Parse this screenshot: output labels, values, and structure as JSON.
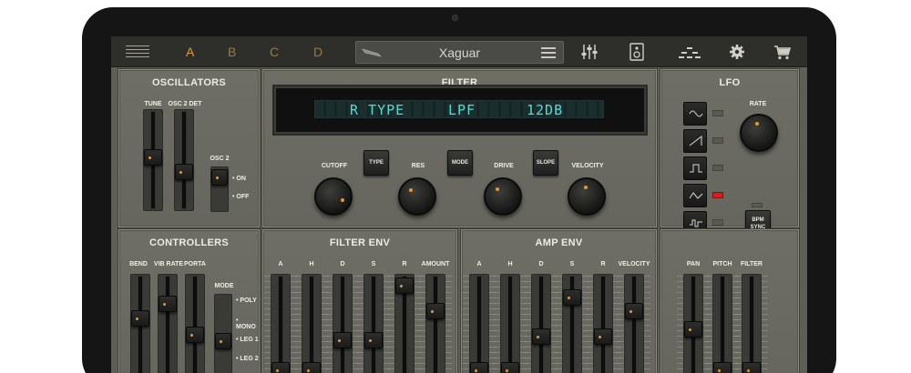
{
  "topbar": {
    "preset_slots": [
      "A",
      "B",
      "C",
      "D"
    ],
    "preset_name": "Xaguar",
    "icons": [
      "mixer-icon",
      "speaker-icon",
      "sequencer-icon",
      "gear-icon",
      "cart-icon"
    ],
    "active_slot_color": "#e69838",
    "slot_color": "#9c7a3e"
  },
  "oscillators": {
    "title": "OSCILLATORS",
    "tune_label": "TUNE",
    "osc2det_label": "OSC 2 DET",
    "osc2_label": "OSC 2",
    "on_label": "ON",
    "off_label": "OFF"
  },
  "filter": {
    "title": "FILTER",
    "display": {
      "param": "R TYPE",
      "value": "LPF",
      "slope": "12DB"
    },
    "display_color": "#5ed8cf",
    "buttons": [
      "TYPE",
      "MODE",
      "SLOPE"
    ],
    "knobs": [
      "CUTOFF",
      "RES",
      "DRIVE",
      "VELOCITY"
    ]
  },
  "lfo": {
    "title": "LFO",
    "rate_label": "RATE",
    "bpm_sync_line1": "BPM",
    "bpm_sync_line2": "SYNC",
    "waveforms": [
      "sine-wave-icon",
      "saw-wave-icon",
      "square-wave-icon",
      "triangle-wave-icon",
      "random-wave-icon"
    ],
    "active_index": 3
  },
  "controllers": {
    "title": "CONTROLLERS",
    "bend_label": "BEND",
    "vib_rate_label": "VIB RATE",
    "porta_label": "PORTA",
    "mode_label": "MODE",
    "modes": [
      "POLY",
      "MONO",
      "LEG 1",
      "LEG 2"
    ]
  },
  "filter_env": {
    "title": "FILTER ENV",
    "labels": [
      "A",
      "H",
      "D",
      "S",
      "R",
      "AMOUNT"
    ],
    "levels": [
      0.05,
      0.05,
      0.38,
      0.38,
      0.98,
      0.7
    ]
  },
  "amp_env": {
    "title": "AMP ENV",
    "labels": [
      "A",
      "H",
      "D",
      "S",
      "R",
      "VELOCITY"
    ],
    "levels": [
      0.05,
      0.05,
      0.42,
      0.85,
      0.42,
      0.7
    ]
  },
  "lfo_dest": {
    "labels": [
      "PAN",
      "PITCH",
      "FILTER"
    ],
    "levels": [
      0.5,
      0.05,
      0.05
    ]
  }
}
